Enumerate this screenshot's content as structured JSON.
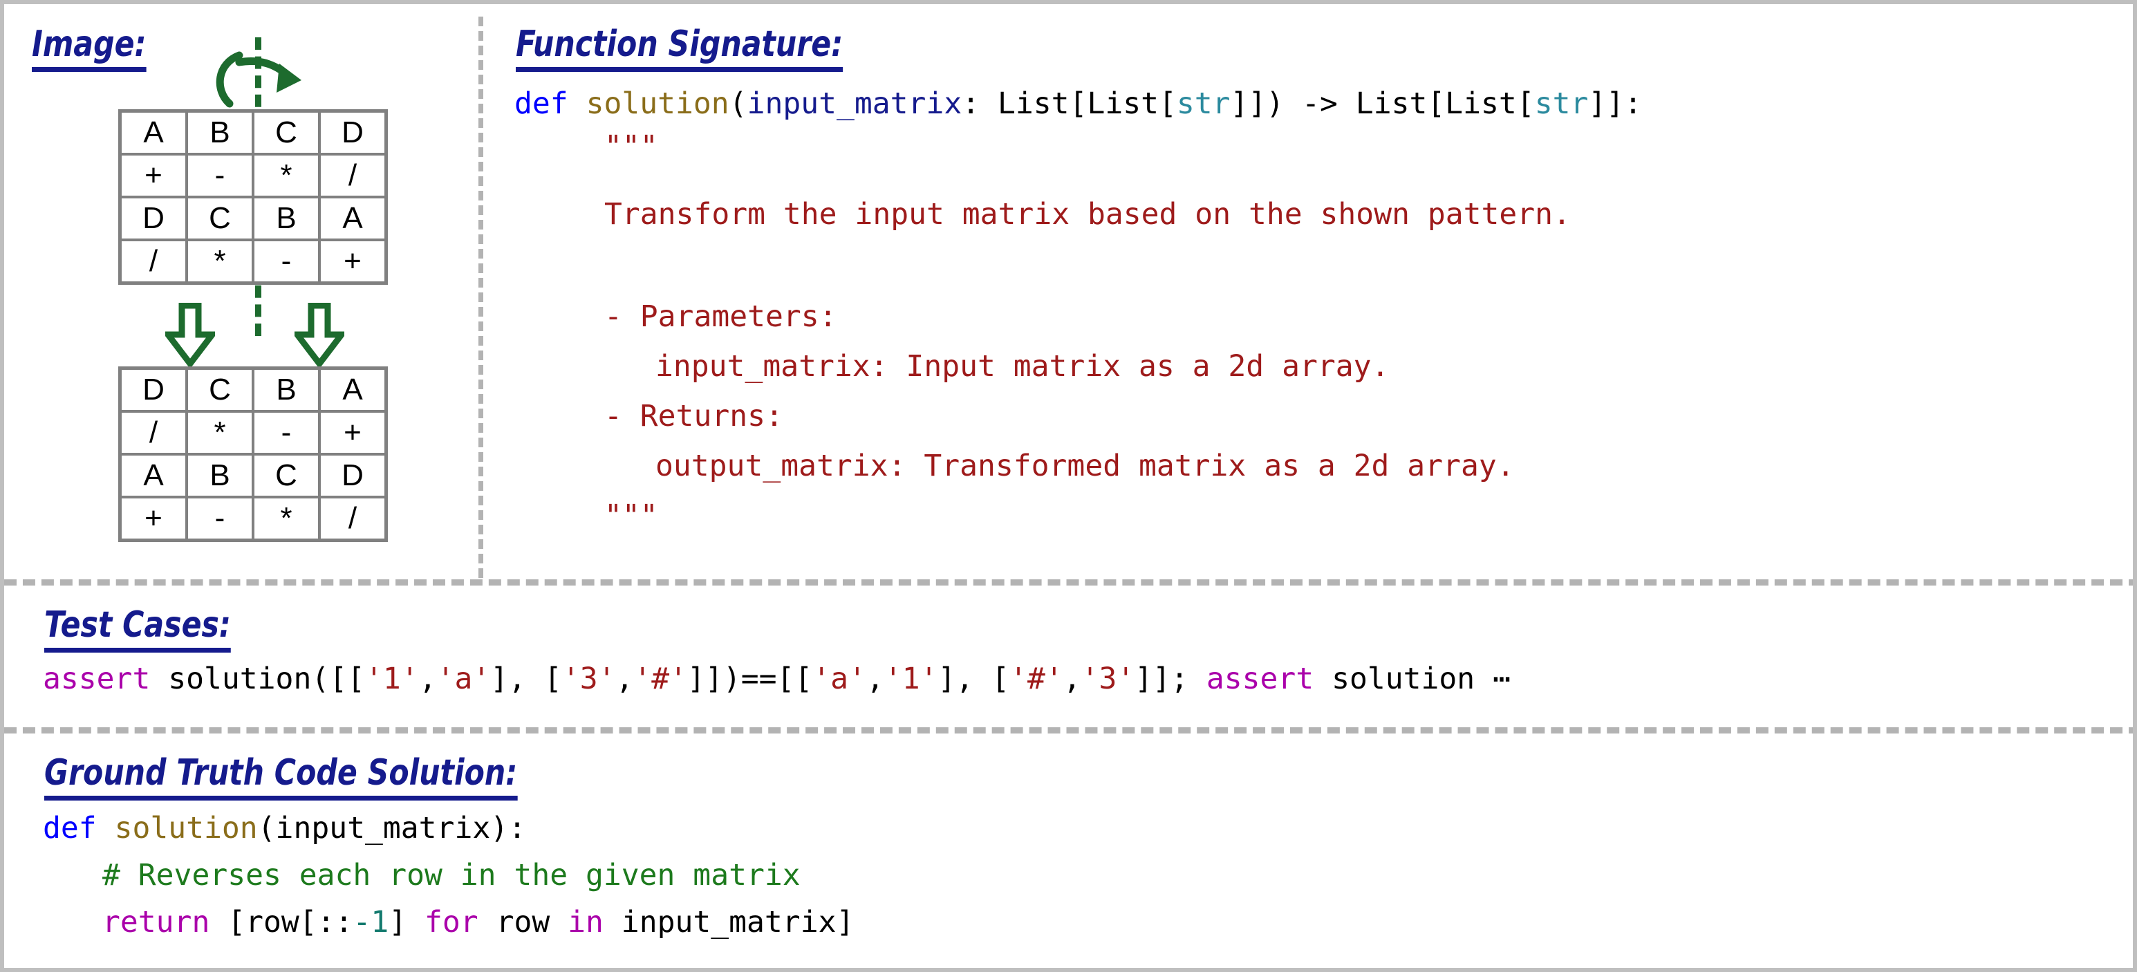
{
  "sections": {
    "image_heading": "Image:",
    "signature_heading": "Function Signature:",
    "testcases_heading": "Test Cases:",
    "groundtruth_heading": "Ground Truth Code Solution:"
  },
  "colors": {
    "heading": "#151b8d",
    "divider": "#b3b3b3",
    "matrix_border": "#808080",
    "annotation_green": "#1d6b2e",
    "keyword_blue": "#0000ff",
    "function_gold": "#8a6d1a",
    "param_navy": "#151b8d",
    "builtin_teal": "#2b8a9e",
    "docstring_red": "#9e1b1b",
    "keyword_magenta": "#aa00aa",
    "comment_green": "#1d7a1d",
    "number_teal": "#137a6e",
    "page_border": "#bfbfbf"
  },
  "diagram": {
    "input_matrix": [
      [
        "A",
        "B",
        "C",
        "D"
      ],
      [
        "+",
        "-",
        "*",
        "/"
      ],
      [
        "D",
        "C",
        "B",
        "A"
      ],
      [
        "/",
        "*",
        "-",
        "+"
      ]
    ],
    "output_matrix": [
      [
        "D",
        "C",
        "B",
        "A"
      ],
      [
        "/",
        "*",
        "-",
        "+"
      ],
      [
        "A",
        "B",
        "C",
        "D"
      ],
      [
        "+",
        "-",
        "*",
        "/"
      ]
    ],
    "annotations": {
      "rotation_axis": "vertical-dashed-axis",
      "rotation_arrow": "curved-rotate-arrow",
      "down_arrow_left": "down-arrow",
      "down_arrow_right": "down-arrow"
    }
  },
  "signature": {
    "line1": {
      "def": "def",
      "name": "solution",
      "open_paren": "(",
      "arg": "input_matrix",
      "colon_space": ": ",
      "type_open": "List[List[",
      "type_inner": "str",
      "type_close": "]])",
      "arrow": " -> ",
      "ret_open": "List[List[",
      "ret_inner": "str",
      "ret_close": "]]:"
    },
    "docstring_open": "\"\"\"",
    "doc_summary": "Transform the input matrix based on the shown pattern.",
    "doc_params_label": "- Parameters:",
    "doc_param_line": "input_matrix: Input matrix as a 2d array.",
    "doc_returns_label": "- Returns:",
    "doc_return_line": "output_matrix: Transformed matrix as a 2d array.",
    "docstring_close": "\"\"\""
  },
  "test_cases": {
    "kw_assert_1": "assert",
    "call_1": " solution([[",
    "s1": "'1'",
    "sep1": ",",
    "s2": "'a'",
    "mid1": "], [",
    "s3": "'3'",
    "sep2": ",",
    "s4": "'#'",
    "mid2": "]])==[[",
    "s5": "'a'",
    "sep3": ",",
    "s6": "'1'",
    "mid3": "], [",
    "s7": "'#'",
    "sep4": ",",
    "s8": "'3'",
    "tail": "]]; ",
    "kw_assert_2": "assert",
    "tail2": " solution ",
    "ellipsis": "⋯"
  },
  "ground_truth": {
    "def": "def",
    "name": "solution",
    "sig_rest": "(input_matrix):",
    "comment": "# Reverses each row in the given matrix",
    "return_kw": "return",
    "expr_a": " [row[::",
    "expr_num": "-1",
    "expr_b": "] ",
    "for_kw": "for",
    "expr_c": " row ",
    "in_kw": "in",
    "expr_d": " input_matrix]"
  }
}
